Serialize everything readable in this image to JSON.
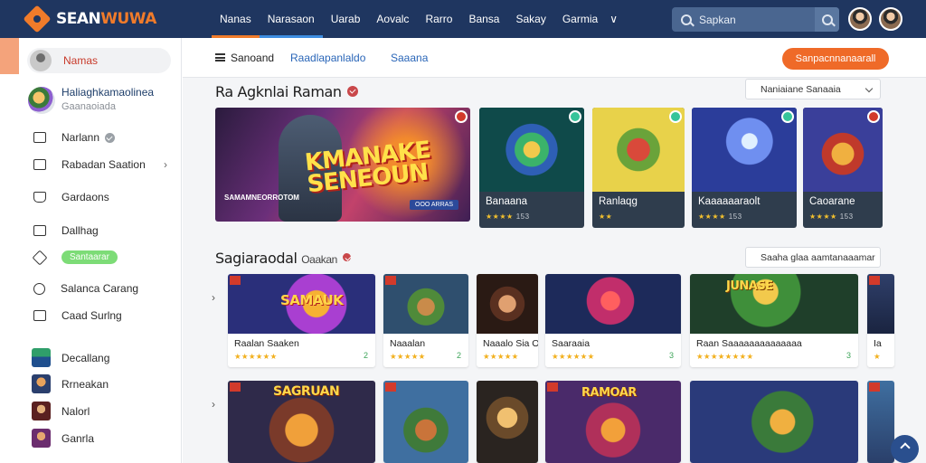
{
  "brand": {
    "name_a": "SEAN",
    "name_b": "WUWA"
  },
  "topnav": {
    "items": [
      "Nanas",
      "Narasaon",
      "Uarab",
      "Aovalc",
      "Rarro",
      "Bansa",
      "Sakay",
      "Garmia"
    ]
  },
  "search": {
    "placeholder": "Sapkan"
  },
  "sidebar": {
    "first_label": "Namas",
    "profile_name": "Haliaghkamaolinea",
    "profile_sub": "Gaanaoiada",
    "items": [
      {
        "label": "Narlann"
      },
      {
        "label": "Rabadan Saation"
      },
      {
        "label": "Gardaons"
      },
      {
        "label": "Dallhag",
        "badge": "Santaarar"
      },
      {
        "label": "Salanca Carang"
      },
      {
        "label": "Caad Surlng"
      }
    ],
    "games": [
      {
        "label": "Decallang"
      },
      {
        "label": "Rrneakan"
      },
      {
        "label": "Nalorl"
      },
      {
        "label": "Ganrla"
      }
    ]
  },
  "subnav": {
    "a": "Sanoand",
    "b": "Raadlapanlaldo",
    "c": "Saaana",
    "cta": "Sanpacnnanaarall"
  },
  "featured": {
    "title": "Ra Agknlai Raman",
    "sort_label": "Naniaiane Sanaaia",
    "hero": {
      "title": "KMANAKE SENEOUN",
      "caption": "SAMAMNEORROTOM",
      "tag": "OOO ARRAS"
    },
    "cards": [
      {
        "name": "Banaana",
        "stars": "★★★★",
        "count": "153",
        "accent": "#2d9b8c"
      },
      {
        "name": "Ranlaqg",
        "stars": "★★",
        "count": "",
        "accent": "#c7b53a"
      },
      {
        "name": "Kaaaaaaraolt",
        "stars": "★★★★",
        "count": "153",
        "accent": "#4a74c9"
      },
      {
        "name": "Caoarane",
        "stars": "★★★★",
        "count": "153",
        "accent": "#c24a3b"
      }
    ]
  },
  "section2": {
    "title": "Sagiaraodal",
    "tag": "Oaakan",
    "sort_label": "Saaha glaa aamtanaaamar",
    "row1": [
      {
        "name": "Raalan Saaken",
        "stars": "★★★★★★",
        "count": "2",
        "art": "SAMAUK"
      },
      {
        "name": "Naaalan",
        "stars": "★★★★★",
        "count": "2",
        "art": ""
      },
      {
        "name": "Naaalo Sia Ola",
        "stars": "★★★★★",
        "count": "",
        "art": ""
      },
      {
        "name": "Saaraaia",
        "stars": "★★★★★★",
        "count": "3",
        "art": ""
      },
      {
        "name": "Raan Saaaaaaaaaaaaaa",
        "stars": "★★★★★★★★",
        "count": "3",
        "art": "JUNASE"
      },
      {
        "name": "Ia",
        "stars": "★",
        "count": "",
        "art": ""
      }
    ],
    "row2": [
      {
        "art": "SAGRUAN"
      },
      {
        "art": ""
      },
      {
        "art": ""
      },
      {
        "art": "RAMOAR"
      },
      {
        "art": ""
      },
      {
        "art": ""
      }
    ]
  },
  "colors": {
    "topbar": "#1f3660",
    "accent": "#f07b2a",
    "link": "#2a66b8"
  },
  "icons": {
    "search": "search-icon",
    "scroll_top": "arrow-up-icon"
  }
}
